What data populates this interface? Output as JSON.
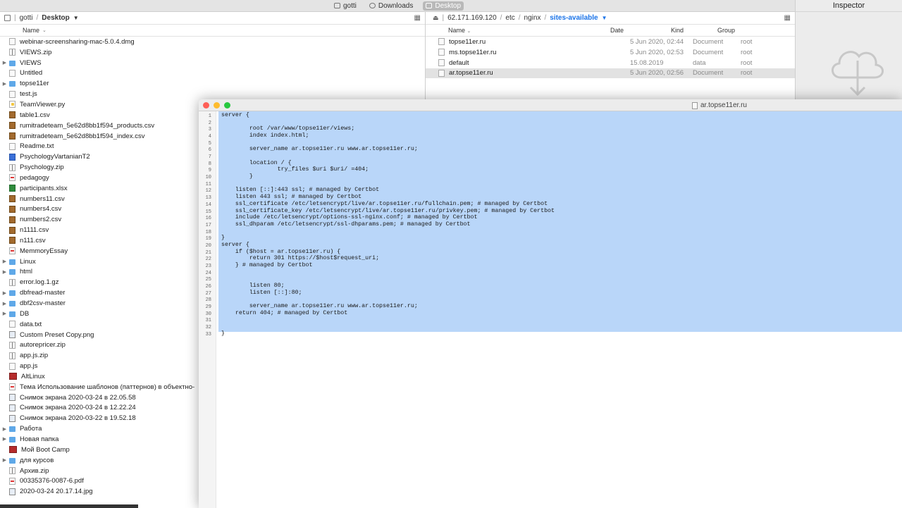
{
  "tabbar": {
    "tabs": [
      {
        "label": "gotti",
        "icon": "home-icon"
      },
      {
        "label": "Downloads",
        "icon": "downloads-icon"
      },
      {
        "label": "Desktop",
        "icon": "desktop-icon",
        "active": true
      }
    ]
  },
  "inspector": {
    "title": "Inspector",
    "icon": "cloud-download-icon"
  },
  "left_pane": {
    "path": [
      "gotti",
      "Desktop"
    ],
    "column_name": "Name",
    "files": [
      {
        "name": "webinar-screensharing-mac-5.0.4.dmg",
        "type": "file"
      },
      {
        "name": "VIEWS.zip",
        "type": "zip"
      },
      {
        "name": "VIEWS",
        "type": "folder"
      },
      {
        "name": "Untitled",
        "type": "file"
      },
      {
        "name": "topse11er",
        "type": "folder"
      },
      {
        "name": "test.js",
        "type": "file"
      },
      {
        "name": "TeamViewer.py",
        "type": "py"
      },
      {
        "name": "table1.csv",
        "type": "csv"
      },
      {
        "name": "rumitradeteam_5e62d8bb1f594_products.csv",
        "type": "csv"
      },
      {
        "name": "rumitradeteam_5e62d8bb1f594_index.csv",
        "type": "csv"
      },
      {
        "name": "Readme.txt",
        "type": "file"
      },
      {
        "name": "PsychologyVartanianT2",
        "type": "doc"
      },
      {
        "name": "Psychology.zip",
        "type": "zip"
      },
      {
        "name": "pedagogy",
        "type": "link"
      },
      {
        "name": "participants.xlsx",
        "type": "xls"
      },
      {
        "name": "numbers11.csv",
        "type": "csv"
      },
      {
        "name": "numbers4.csv",
        "type": "csv"
      },
      {
        "name": "numbers2.csv",
        "type": "csv"
      },
      {
        "name": "n1111.csv",
        "type": "csv"
      },
      {
        "name": "n111.csv",
        "type": "csv"
      },
      {
        "name": "MemmoryEssay",
        "type": "link"
      },
      {
        "name": "Linux",
        "type": "folder"
      },
      {
        "name": "html",
        "type": "folder"
      },
      {
        "name": "error.log.1.gz",
        "type": "zip"
      },
      {
        "name": "dbfread-master",
        "type": "folder"
      },
      {
        "name": "dbf2csv-master",
        "type": "folder"
      },
      {
        "name": "DB",
        "type": "folder"
      },
      {
        "name": "data.txt",
        "type": "file"
      },
      {
        "name": "Custom Preset Copy.png",
        "type": "img"
      },
      {
        "name": "autorepricer.zip",
        "type": "zip"
      },
      {
        "name": "app.js.zip",
        "type": "zip"
      },
      {
        "name": "app.js",
        "type": "file"
      },
      {
        "name": "AltLinux",
        "type": "red"
      },
      {
        "name": "Тема  Использование шаблонов (паттернов) в объектно-",
        "type": "link"
      },
      {
        "name": "Снимок экрана 2020-03-24 в 22.05.58",
        "type": "img"
      },
      {
        "name": "Снимок экрана 2020-03-24 в 12.22.24",
        "type": "img"
      },
      {
        "name": "Снимок экрана 2020-03-22 в 19.52.18",
        "type": "img"
      },
      {
        "name": "Работа",
        "type": "folder"
      },
      {
        "name": "Новая папка",
        "type": "folder"
      },
      {
        "name": "Мой Boot Camp",
        "type": "red"
      },
      {
        "name": "для курсов",
        "type": "folder"
      },
      {
        "name": "Архив.zip",
        "type": "zip"
      },
      {
        "name": "00335376-0087-6.pdf",
        "type": "link"
      },
      {
        "name": "2020-03-24 20.17.14.jpg",
        "type": "img"
      }
    ]
  },
  "right_pane": {
    "path": [
      "62.171.169.120",
      "etc",
      "nginx",
      "sites-available"
    ],
    "columns": {
      "name": "Name",
      "date": "Date",
      "kind": "Kind",
      "group": "Group"
    },
    "files": [
      {
        "name": "topse11er.ru",
        "date": "5 Jun 2020, 02:44",
        "kind": "Document",
        "group": "root"
      },
      {
        "name": "ms.topse11er.ru",
        "date": "5 Jun 2020, 02:53",
        "kind": "Document",
        "group": "root"
      },
      {
        "name": "default",
        "date": "15.08.2019",
        "kind": "data",
        "group": "root"
      },
      {
        "name": "ar.topse11er.ru",
        "date": "5 Jun 2020, 02:56",
        "kind": "Document",
        "group": "root",
        "selected": true
      }
    ]
  },
  "editor": {
    "title": "ar.topse11er.ru",
    "selection_end_line": 33,
    "lines": [
      "server {",
      "",
      "        root /var/www/topse11er/views;",
      "        index index.html;",
      "",
      "        server_name ar.topse11er.ru www.ar.topse11er.ru;",
      "",
      "        location / {",
      "                try_files $uri $uri/ =404;",
      "        }",
      "",
      "    listen [::]:443 ssl; # managed by Certbot",
      "    listen 443 ssl; # managed by Certbot",
      "    ssl_certificate /etc/letsencrypt/live/ar.topse11er.ru/fullchain.pem; # managed by Certbot",
      "    ssl_certificate_key /etc/letsencrypt/live/ar.topse11er.ru/privkey.pem; # managed by Certbot",
      "    include /etc/letsencrypt/options-ssl-nginx.conf; # managed by Certbot",
      "    ssl_dhparam /etc/letsencrypt/ssl-dhparams.pem; # managed by Certbot",
      "",
      "}",
      "server {",
      "    if ($host = ar.topse11er.ru) {",
      "        return 301 https://$host$request_uri;",
      "    } # managed by Certbot",
      "",
      "",
      "        listen 80;",
      "        listen [::]:80;",
      "",
      "        server_name ar.topse11er.ru www.ar.topse11er.ru;",
      "    return 404; # managed by Certbot",
      "",
      "",
      "}"
    ]
  },
  "colors": {
    "selection": "#b9d6f9",
    "folder": "#5fa8e8",
    "accent": "#1a73e8",
    "close": "#fe5f57",
    "minimize": "#febc2e",
    "zoom": "#28c840"
  }
}
